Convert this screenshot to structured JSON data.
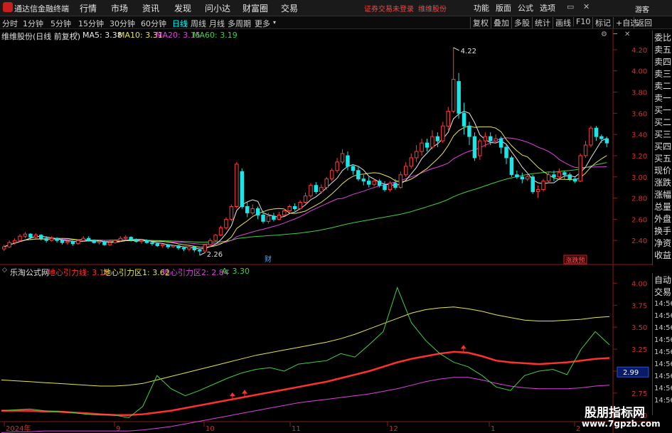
{
  "titlebar": {
    "app_name": "通达信金融终端",
    "menus": [
      "行情",
      "市场",
      "资讯",
      "发现",
      "问小达",
      "财富圈",
      "交易"
    ],
    "notice": "证券交易未登录",
    "stock_name_tag": "维维股份",
    "right_menus": [
      "功能",
      "版面",
      "公式",
      "选项"
    ],
    "user": "游客"
  },
  "period_bar": {
    "periods": [
      "分时",
      "1分钟",
      "5分钟",
      "15分钟",
      "30分钟",
      "60分钟",
      "日线",
      "周线",
      "月线",
      "多周期",
      "更多"
    ],
    "active": "日线",
    "tools": [
      "复权",
      "叠加",
      "多股",
      "统计",
      "画线",
      "F10",
      "标记",
      "+自选",
      "返回"
    ]
  },
  "price_chart": {
    "title": "维维股份(日线 前复权)",
    "ma": [
      {
        "label": "MA5: 3.38",
        "color": "#e8e8e8"
      },
      {
        "label": "MA10: 3.31",
        "color": "#e6e64a"
      },
      {
        "label": "MA20: 3.15",
        "color": "#e040e0"
      },
      {
        "label": "MA60: 3.19",
        "color": "#40d040"
      }
    ],
    "y_ticks": [
      "4.20",
      "4.00",
      "3.80",
      "3.60",
      "3.40",
      "3.20",
      "3.00",
      "2.80",
      "2.60",
      "2.40"
    ],
    "high_label": "4.22",
    "low_label": "2.26",
    "event_label": "财",
    "tag_label": "涨跌预"
  },
  "indicator_chart": {
    "title": "乐淘公式网",
    "lines": [
      {
        "label": "地心引力线: 3.15",
        "color": "#ff3030"
      },
      {
        "label": "地心引力区1: 3.62",
        "color": "#e6e64a"
      },
      {
        "label": "地心引力区2: 2.84",
        "color": "#e040e0"
      },
      {
        "label": "A: 3.30",
        "color": "#40d040"
      }
    ],
    "y_ticks": [
      "4.00",
      "3.75",
      "3.50",
      "3.25",
      "3.00",
      "2.75",
      "2.50"
    ],
    "cursor_value": "2.99"
  },
  "x_axis": {
    "labels": [
      "2024年",
      "9",
      "10",
      "11",
      "12",
      "1",
      "2"
    ]
  },
  "side_panel": {
    "top_items": [
      "委比",
      "卖五",
      "卖四",
      "卖三",
      "卖二",
      "卖一",
      "买一",
      "买二",
      "买三",
      "买四",
      "买五",
      "现价",
      "涨跌",
      "涨幅",
      "总量",
      "外盘",
      "换手",
      "净资",
      "收益"
    ],
    "bottom_items": [
      "自动",
      "交易",
      "14:56",
      "14:56",
      "14:56",
      "14:56",
      "14:56",
      "14:56",
      "14:56",
      "14:56",
      "14:56"
    ]
  },
  "watermark": {
    "text": "股朋指标网",
    "url": "www.7gpzb.com"
  },
  "chart_data": [
    {
      "type": "candlestick",
      "title": "维维股份(日线 前复权)",
      "ylim": [
        2.2,
        4.3
      ],
      "x_ticks": [
        "2024年",
        "9",
        "10",
        "11",
        "12",
        "1",
        "2"
      ],
      "candles": [
        [
          2.32,
          2.34,
          2.3,
          2.36
        ],
        [
          2.34,
          2.38,
          2.33,
          2.4
        ],
        [
          2.38,
          2.4,
          2.36,
          2.42
        ],
        [
          2.4,
          2.44,
          2.39,
          2.46
        ],
        [
          2.44,
          2.46,
          2.42,
          2.48
        ],
        [
          2.46,
          2.43,
          2.41,
          2.47
        ],
        [
          2.43,
          2.45,
          2.42,
          2.47
        ],
        [
          2.45,
          2.42,
          2.4,
          2.46
        ],
        [
          2.42,
          2.4,
          2.38,
          2.44
        ],
        [
          2.4,
          2.42,
          2.39,
          2.44
        ],
        [
          2.42,
          2.4,
          2.38,
          2.43
        ],
        [
          2.4,
          2.38,
          2.36,
          2.42
        ],
        [
          2.38,
          2.39,
          2.36,
          2.41
        ],
        [
          2.39,
          2.37,
          2.35,
          2.4
        ],
        [
          2.37,
          2.4,
          2.36,
          2.41
        ],
        [
          2.4,
          2.42,
          2.39,
          2.44
        ],
        [
          2.42,
          2.4,
          2.39,
          2.44
        ],
        [
          2.4,
          2.38,
          2.37,
          2.41
        ],
        [
          2.38,
          2.39,
          2.36,
          2.4
        ],
        [
          2.39,
          2.36,
          2.35,
          2.4
        ],
        [
          2.36,
          2.38,
          2.35,
          2.4
        ],
        [
          2.38,
          2.4,
          2.37,
          2.41
        ],
        [
          2.4,
          2.42,
          2.39,
          2.44
        ],
        [
          2.42,
          2.43,
          2.4,
          2.45
        ],
        [
          2.43,
          2.41,
          2.39,
          2.44
        ],
        [
          2.41,
          2.39,
          2.38,
          2.42
        ],
        [
          2.39,
          2.4,
          2.37,
          2.41
        ],
        [
          2.4,
          2.38,
          2.37,
          2.41
        ],
        [
          2.38,
          2.37,
          2.35,
          2.39
        ],
        [
          2.37,
          2.35,
          2.34,
          2.38
        ],
        [
          2.35,
          2.36,
          2.33,
          2.37
        ],
        [
          2.36,
          2.34,
          2.32,
          2.37
        ],
        [
          2.34,
          2.35,
          2.33,
          2.36
        ],
        [
          2.35,
          2.33,
          2.31,
          2.36
        ],
        [
          2.33,
          2.32,
          2.3,
          2.34
        ],
        [
          2.32,
          2.34,
          2.3,
          2.35
        ],
        [
          2.34,
          2.31,
          2.29,
          2.35
        ],
        [
          2.31,
          2.3,
          2.26,
          2.32
        ],
        [
          2.3,
          2.36,
          2.29,
          2.37
        ],
        [
          2.36,
          2.4,
          2.34,
          2.42
        ],
        [
          2.4,
          2.45,
          2.39,
          2.46
        ],
        [
          2.45,
          2.52,
          2.44,
          2.54
        ],
        [
          2.52,
          2.6,
          2.5,
          2.62
        ],
        [
          2.6,
          2.72,
          2.58,
          2.74
        ],
        [
          2.72,
          3.12,
          2.7,
          3.14
        ],
        [
          3.05,
          2.72,
          2.7,
          3.08
        ],
        [
          2.72,
          2.66,
          2.62,
          2.76
        ],
        [
          2.66,
          2.7,
          2.64,
          2.74
        ],
        [
          2.7,
          2.64,
          2.6,
          2.72
        ],
        [
          2.64,
          2.58,
          2.56,
          2.68
        ],
        [
          2.58,
          2.63,
          2.56,
          2.66
        ],
        [
          2.63,
          2.6,
          2.58,
          2.66
        ],
        [
          2.6,
          2.64,
          2.59,
          2.67
        ],
        [
          2.64,
          2.68,
          2.63,
          2.7
        ],
        [
          2.68,
          2.72,
          2.66,
          2.74
        ],
        [
          2.72,
          2.7,
          2.68,
          2.75
        ],
        [
          2.7,
          2.76,
          2.69,
          2.78
        ],
        [
          2.76,
          2.82,
          2.75,
          2.85
        ],
        [
          2.82,
          2.92,
          2.8,
          2.94
        ],
        [
          2.92,
          2.86,
          2.84,
          2.95
        ],
        [
          2.86,
          2.9,
          2.84,
          2.93
        ],
        [
          2.9,
          2.98,
          2.88,
          3.0
        ],
        [
          2.98,
          3.06,
          2.96,
          3.08
        ],
        [
          3.06,
          3.14,
          3.04,
          3.18
        ],
        [
          3.14,
          3.22,
          3.12,
          3.26
        ],
        [
          3.2,
          3.1,
          3.06,
          3.24
        ],
        [
          3.1,
          3.06,
          3.02,
          3.12
        ],
        [
          3.06,
          2.98,
          2.96,
          3.1
        ],
        [
          2.98,
          2.96,
          2.92,
          3.02
        ],
        [
          2.96,
          2.93,
          2.9,
          3.0
        ],
        [
          2.93,
          2.96,
          2.91,
          2.98
        ],
        [
          2.96,
          2.92,
          2.9,
          2.98
        ],
        [
          2.92,
          2.88,
          2.86,
          2.96
        ],
        [
          2.88,
          2.94,
          2.86,
          2.96
        ],
        [
          2.94,
          2.9,
          2.88,
          2.98
        ],
        [
          2.9,
          3.02,
          2.89,
          3.05
        ],
        [
          3.02,
          3.1,
          3.0,
          3.14
        ],
        [
          3.1,
          3.18,
          3.08,
          3.22
        ],
        [
          3.18,
          3.24,
          3.14,
          3.3
        ],
        [
          3.24,
          3.32,
          3.2,
          3.36
        ],
        [
          3.32,
          3.28,
          3.24,
          3.36
        ],
        [
          3.28,
          3.38,
          3.26,
          3.44
        ],
        [
          3.38,
          3.34,
          3.28,
          3.42
        ],
        [
          3.34,
          3.48,
          3.32,
          3.52
        ],
        [
          3.48,
          3.62,
          3.44,
          3.66
        ],
        [
          3.62,
          3.92,
          3.6,
          4.22
        ],
        [
          3.9,
          3.6,
          3.55,
          3.98
        ],
        [
          3.6,
          3.48,
          3.4,
          3.7
        ],
        [
          3.48,
          3.38,
          3.3,
          3.52
        ],
        [
          3.38,
          3.18,
          3.15,
          3.42
        ],
        [
          3.2,
          3.34,
          3.16,
          3.36
        ],
        [
          3.34,
          3.38,
          3.28,
          3.42
        ],
        [
          3.38,
          3.34,
          3.3,
          3.42
        ],
        [
          3.34,
          3.36,
          3.32,
          3.4
        ],
        [
          3.36,
          3.28,
          3.22,
          3.38
        ],
        [
          3.28,
          3.18,
          3.12,
          3.3
        ],
        [
          3.18,
          3.02,
          3.0,
          3.2
        ],
        [
          3.02,
          3.0,
          2.98,
          3.06
        ],
        [
          3.0,
          2.98,
          2.94,
          3.04
        ],
        [
          2.98,
          3.0,
          2.96,
          3.04
        ],
        [
          3.0,
          2.86,
          2.84,
          3.02
        ],
        [
          2.86,
          2.88,
          2.8,
          2.92
        ],
        [
          2.88,
          2.96,
          2.86,
          2.98
        ],
        [
          2.96,
          3.02,
          2.94,
          3.04
        ],
        [
          3.02,
          3.0,
          2.96,
          3.06
        ],
        [
          3.0,
          3.04,
          2.98,
          3.08
        ],
        [
          3.04,
          3.02,
          2.98,
          3.06
        ],
        [
          3.02,
          2.98,
          2.96,
          3.04
        ],
        [
          2.98,
          2.96,
          2.94,
          3.0
        ],
        [
          2.96,
          3.2,
          2.95,
          3.22
        ],
        [
          3.2,
          3.3,
          3.18,
          3.34
        ],
        [
          3.3,
          3.46,
          3.28,
          3.48
        ],
        [
          3.46,
          3.38,
          3.34,
          3.48
        ],
        [
          3.38,
          3.36,
          3.32,
          3.4
        ],
        [
          3.36,
          3.32,
          3.28,
          3.38
        ]
      ]
    },
    {
      "type": "line",
      "title": "乐淘公式网",
      "ylim": [
        2.45,
        4.1
      ],
      "series": [
        {
          "name": "地心引力线",
          "color": "#ff3030",
          "values": [
            2.55,
            2.55,
            2.55,
            2.54,
            2.54,
            2.53,
            2.52,
            2.51,
            2.5,
            2.5,
            2.51,
            2.53,
            2.55,
            2.58,
            2.61,
            2.64,
            2.67,
            2.7,
            2.73,
            2.76,
            2.79,
            2.82,
            2.85,
            2.88,
            2.92,
            2.96,
            3.0,
            3.05,
            3.1,
            3.14,
            3.17,
            3.2,
            3.22,
            3.21,
            3.17,
            3.12,
            3.1,
            3.09,
            3.08,
            3.09,
            3.1,
            3.12,
            3.14,
            3.15
          ]
        },
        {
          "name": "地心引力区1",
          "color": "#e6e64a",
          "values": [
            2.9,
            2.89,
            2.88,
            2.87,
            2.86,
            2.85,
            2.84,
            2.83,
            2.83,
            2.84,
            2.86,
            2.9,
            2.94,
            2.98,
            3.02,
            3.06,
            3.1,
            3.14,
            3.18,
            3.21,
            3.24,
            3.27,
            3.3,
            3.33,
            3.37,
            3.42,
            3.48,
            3.54,
            3.6,
            3.66,
            3.7,
            3.72,
            3.73,
            3.71,
            3.68,
            3.64,
            3.61,
            3.58,
            3.57,
            3.57,
            3.58,
            3.59,
            3.61,
            3.62
          ]
        },
        {
          "name": "地心引力区2",
          "color": "#e040e0",
          "values": [
            2.3,
            2.31,
            2.31,
            2.32,
            2.32,
            2.32,
            2.32,
            2.32,
            2.32,
            2.32,
            2.33,
            2.35,
            2.37,
            2.4,
            2.43,
            2.46,
            2.49,
            2.52,
            2.55,
            2.58,
            2.61,
            2.64,
            2.66,
            2.68,
            2.7,
            2.72,
            2.74,
            2.77,
            2.8,
            2.84,
            2.88,
            2.91,
            2.93,
            2.93,
            2.9,
            2.86,
            2.83,
            2.81,
            2.8,
            2.8,
            2.8,
            2.81,
            2.83,
            2.84
          ]
        },
        {
          "name": "A",
          "color": "#40d040",
          "values": [
            2.55,
            2.56,
            2.57,
            2.55,
            2.54,
            2.53,
            2.51,
            2.5,
            2.5,
            2.47,
            2.6,
            2.95,
            2.8,
            2.72,
            2.78,
            2.85,
            2.92,
            2.98,
            3.02,
            3.04,
            3.0,
            3.08,
            3.1,
            3.12,
            3.2,
            3.16,
            3.3,
            3.45,
            3.95,
            3.55,
            3.35,
            3.2,
            3.1,
            3.05,
            2.95,
            2.82,
            2.78,
            2.95,
            3.0,
            3.02,
            2.96,
            3.25,
            3.45,
            3.3
          ]
        }
      ]
    }
  ]
}
